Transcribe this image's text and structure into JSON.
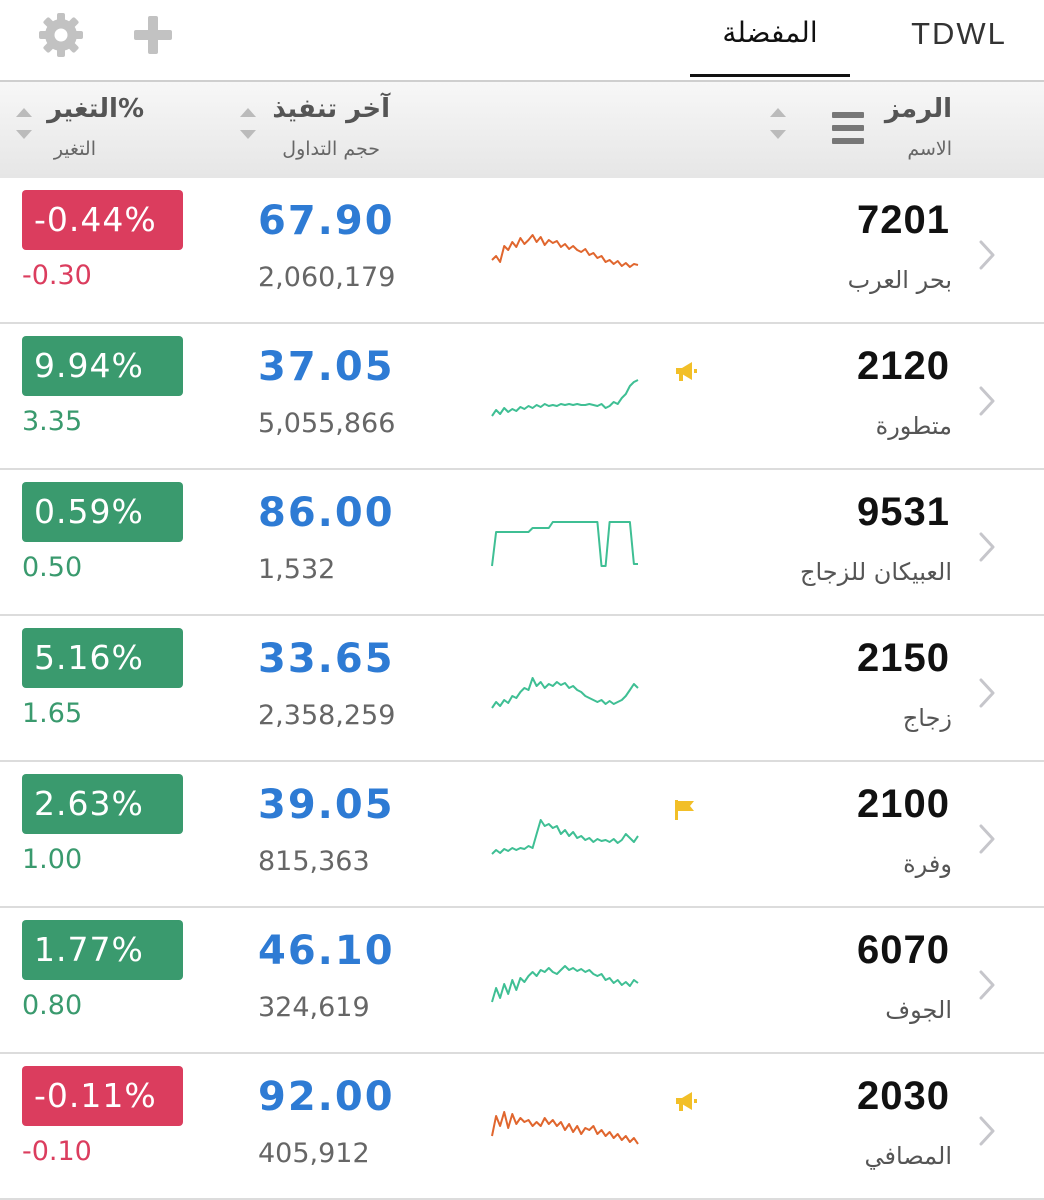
{
  "toolbar": {
    "settings_icon": "gear-icon",
    "add_icon": "plus-icon",
    "tabs": [
      {
        "label": "المفضلة",
        "active": true
      },
      {
        "label": "TDWL",
        "active": false
      }
    ]
  },
  "header": {
    "symbol_label": "الرمز",
    "name_label": "الاسم",
    "last_label": "آخر تنفيذ",
    "volume_label": "حجم التداول",
    "change_pct_label": "التغير%",
    "change_label": "التغير"
  },
  "colors": {
    "up": "#3a9a6e",
    "down": "#db3d5e",
    "price": "#2e7bd4",
    "spark_up": "#3fbf94",
    "spark_down": "#e0662e",
    "flag": "#f2bf28"
  },
  "rows": [
    {
      "symbol": "7201",
      "name": "بحر العرب",
      "price": "67.90",
      "volume": "2,060,179",
      "change_pct": "-0.44%",
      "change": "-0.30",
      "direction": "down",
      "flag": null,
      "spark": [
        20,
        24,
        18,
        34,
        30,
        38,
        33,
        42,
        36,
        40,
        45,
        38,
        43,
        35,
        40,
        37,
        39,
        33,
        36,
        31,
        34,
        30,
        28,
        31,
        25,
        27,
        22,
        24,
        18,
        20,
        16,
        19,
        14,
        17,
        13,
        16,
        15
      ]
    },
    {
      "symbol": "2120",
      "name": "متطورة",
      "price": "37.05",
      "volume": "5,055,866",
      "change_pct": "9.94%",
      "change": "3.35",
      "direction": "up",
      "flag": "announcement",
      "spark": [
        10,
        16,
        12,
        18,
        14,
        17,
        15,
        19,
        17,
        20,
        18,
        21,
        19,
        22,
        20,
        21,
        20,
        22,
        21,
        22,
        21,
        22,
        21,
        21,
        22,
        21,
        20,
        22,
        18,
        20,
        24,
        22,
        28,
        32,
        40,
        44,
        46
      ]
    },
    {
      "symbol": "9531",
      "name": "العبيكان للزجاج",
      "price": "86.00",
      "volume": "1,532",
      "change_pct": "0.59%",
      "change": "0.50",
      "direction": "up",
      "flag": null,
      "spark": [
        6,
        40,
        40,
        40,
        40,
        40,
        40,
        40,
        40,
        40,
        44,
        44,
        44,
        44,
        44,
        50,
        50,
        50,
        50,
        50,
        50,
        50,
        50,
        50,
        50,
        50,
        50,
        6,
        6,
        50,
        50,
        50,
        50,
        50,
        50,
        8,
        8
      ]
    },
    {
      "symbol": "2150",
      "name": "زجاج",
      "price": "33.65",
      "volume": "2,358,259",
      "change_pct": "5.16%",
      "change": "1.65",
      "direction": "up",
      "flag": null,
      "spark": [
        10,
        16,
        12,
        18,
        15,
        22,
        20,
        26,
        30,
        28,
        40,
        32,
        36,
        30,
        34,
        32,
        36,
        33,
        35,
        30,
        32,
        28,
        26,
        22,
        20,
        18,
        16,
        18,
        14,
        17,
        14,
        16,
        18,
        22,
        28,
        34,
        30
      ]
    },
    {
      "symbol": "2100",
      "name": "وفرة",
      "price": "39.05",
      "volume": "815,363",
      "change_pct": "2.63%",
      "change": "1.00",
      "direction": "up",
      "flag": "flag",
      "spark": [
        10,
        14,
        11,
        15,
        13,
        16,
        14,
        16,
        15,
        18,
        16,
        30,
        44,
        38,
        40,
        36,
        38,
        30,
        34,
        28,
        32,
        26,
        28,
        24,
        26,
        22,
        25,
        23,
        24,
        22,
        25,
        21,
        24,
        30,
        26,
        22,
        28
      ]
    },
    {
      "symbol": "6070",
      "name": "الجوف",
      "price": "46.10",
      "volume": "324,619",
      "change_pct": "1.77%",
      "change": "0.80",
      "direction": "up",
      "flag": null,
      "spark": [
        8,
        22,
        12,
        26,
        16,
        30,
        20,
        32,
        28,
        34,
        38,
        34,
        40,
        38,
        42,
        38,
        36,
        40,
        44,
        40,
        42,
        39,
        41,
        38,
        40,
        36,
        34,
        36,
        30,
        32,
        27,
        30,
        25,
        28,
        24,
        30,
        27
      ]
    },
    {
      "symbol": "2030",
      "name": "المصافي",
      "price": "92.00",
      "volume": "405,912",
      "change_pct": "-0.11%",
      "change": "-0.10",
      "direction": "down",
      "flag": "announcement",
      "spark": [
        20,
        40,
        30,
        44,
        28,
        42,
        32,
        38,
        34,
        36,
        30,
        34,
        30,
        38,
        32,
        36,
        30,
        34,
        26,
        32,
        24,
        30,
        22,
        28,
        26,
        30,
        22,
        26,
        20,
        24,
        18,
        22,
        16,
        20,
        14,
        18,
        12
      ]
    }
  ]
}
